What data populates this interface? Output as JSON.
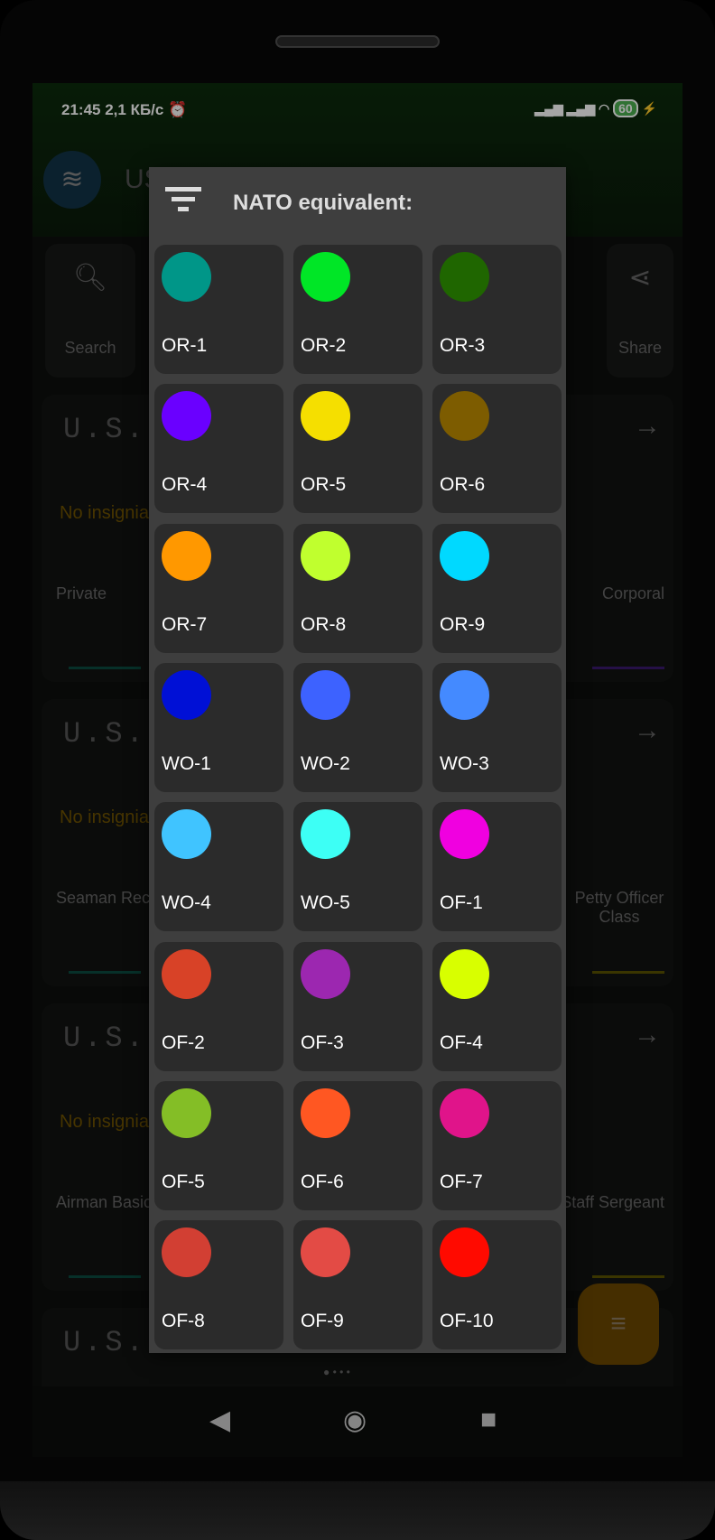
{
  "status": {
    "time": "21:45",
    "speed": "2,1 КБ/с",
    "battery": "60"
  },
  "app": {
    "title": "US"
  },
  "toolbar": {
    "search": "Search",
    "share": "Share"
  },
  "cards": [
    {
      "prefix": "U.S.",
      "no_insignia": "No insignia",
      "left_rank": "Private",
      "right_rank": "Corporal"
    },
    {
      "prefix": "U.S.",
      "no_insignia": "No insignia",
      "left_rank": "Seaman Recruit",
      "right_rank": "Petty Officer Class"
    },
    {
      "prefix": "U.S.",
      "no_insignia": "No insignia",
      "left_rank": "Airman Basic",
      "right_rank": "Staff Sergeant"
    },
    {
      "prefix": "U.S."
    }
  ],
  "dialog": {
    "title": "NATO equivalent:",
    "items": [
      {
        "label": "OR-1",
        "color": "#009688"
      },
      {
        "label": "OR-2",
        "color": "#00e626"
      },
      {
        "label": "OR-3",
        "color": "#1f6600"
      },
      {
        "label": "OR-4",
        "color": "#6a00ff"
      },
      {
        "label": "OR-5",
        "color": "#f5df00"
      },
      {
        "label": "OR-6",
        "color": "#7d5c00"
      },
      {
        "label": "OR-7",
        "color": "#ff9800"
      },
      {
        "label": "OR-8",
        "color": "#c0ff2e"
      },
      {
        "label": "OR-9",
        "color": "#00d9ff"
      },
      {
        "label": "WO-1",
        "color": "#0010d6"
      },
      {
        "label": "WO-2",
        "color": "#3d62ff"
      },
      {
        "label": "WO-3",
        "color": "#448aff"
      },
      {
        "label": "WO-4",
        "color": "#40c4ff"
      },
      {
        "label": "WO-5",
        "color": "#3dfff5"
      },
      {
        "label": "OF-1",
        "color": "#f000e0"
      },
      {
        "label": "OF-2",
        "color": "#d84227"
      },
      {
        "label": "OF-3",
        "color": "#9c27b0"
      },
      {
        "label": "OF-4",
        "color": "#d8ff00"
      },
      {
        "label": "OF-5",
        "color": "#84be26"
      },
      {
        "label": "OF-6",
        "color": "#ff5722"
      },
      {
        "label": "OF-7",
        "color": "#e0148a"
      },
      {
        "label": "OF-8",
        "color": "#d23f33"
      },
      {
        "label": "OF-9",
        "color": "#e34b45"
      },
      {
        "label": "OF-10",
        "color": "#ff0a00"
      }
    ]
  }
}
